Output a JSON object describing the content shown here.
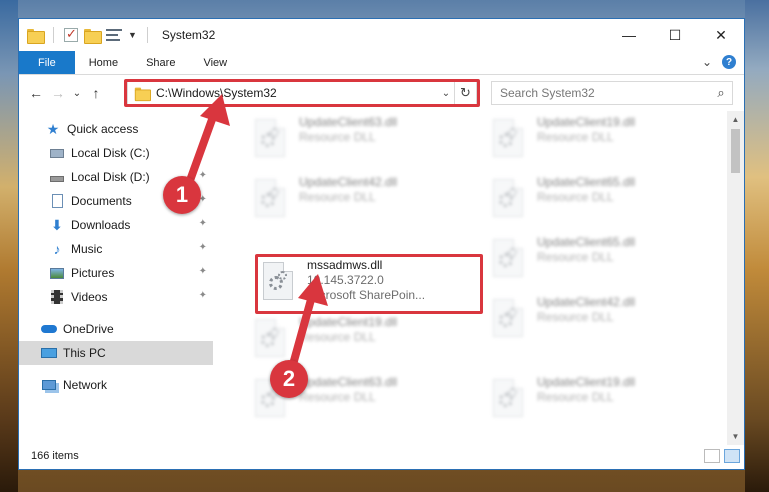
{
  "window": {
    "title": "System32",
    "controls": {
      "minimize": "—",
      "maximize": "☐",
      "close": "✕"
    }
  },
  "ribbon": {
    "tabs": [
      "File",
      "Home",
      "Share",
      "View"
    ],
    "expand": "⌄",
    "help": "?"
  },
  "address": {
    "path": "C:\\Windows\\System32",
    "dropdown": "⌄",
    "refresh": "↻"
  },
  "search": {
    "placeholder": "Search System32",
    "icon": "search-icon"
  },
  "nav_buttons": {
    "back": "←",
    "forward": "→",
    "recent": "⌄",
    "up": "↑"
  },
  "sidebar": {
    "items": [
      {
        "label": "Quick access",
        "icon": "star-icon",
        "pinned": false
      },
      {
        "label": "Local Disk (C:)",
        "icon": "drive-icon",
        "pinned": false
      },
      {
        "label": "Local Disk (D:)",
        "icon": "drive-icon",
        "pinned": true
      },
      {
        "label": "Documents",
        "icon": "documents-icon",
        "pinned": true
      },
      {
        "label": "Downloads",
        "icon": "download-icon",
        "pinned": true
      },
      {
        "label": "Music",
        "icon": "music-icon",
        "pinned": true
      },
      {
        "label": "Pictures",
        "icon": "pictures-icon",
        "pinned": true
      },
      {
        "label": "Videos",
        "icon": "videos-icon",
        "pinned": true
      },
      {
        "label": "OneDrive",
        "icon": "cloud-icon",
        "pinned": false
      },
      {
        "label": "This PC",
        "icon": "computer-icon",
        "pinned": false
      },
      {
        "label": "Network",
        "icon": "network-icon",
        "pinned": false
      }
    ],
    "pin_glyph": "📌"
  },
  "files": [
    {
      "name": "UpdateClient63.dll",
      "type": "Resource DLL",
      "extra": "",
      "blurred": true
    },
    {
      "name": "UpdateClient19.dll",
      "type": "Resource DLL",
      "extra": "",
      "blurred": true
    },
    {
      "name": "UpdateClient42.dll",
      "type": "Resource DLL",
      "extra": "",
      "blurred": true
    },
    {
      "name": "UpdateClient65.dll",
      "type": "Resource DLL",
      "extra": "",
      "blurred": true
    },
    {
      "name": "mssadmws.dll",
      "type": "10.145.3722.0",
      "extra": "Microsoft SharePoin...",
      "blurred": false
    },
    {
      "name": "UpdateClient65.dll",
      "type": "Resource DLL",
      "extra": "",
      "blurred": true
    },
    {
      "name": "UpdateClient19.dll",
      "type": "Resource DLL",
      "extra": "",
      "blurred": true
    },
    {
      "name": "UpdateClient42.dll",
      "type": "Resource DLL",
      "extra": "",
      "blurred": true
    },
    {
      "name": "UpdateClient63.dll",
      "type": "Resource DLL",
      "extra": "",
      "blurred": true
    },
    {
      "name": "UpdateClient19.dll",
      "type": "Resource DLL",
      "extra": "",
      "blurred": true
    }
  ],
  "status": {
    "item_count": "166 items"
  },
  "annotations": {
    "step1": "1",
    "step2": "2",
    "color": "#d9363e"
  }
}
